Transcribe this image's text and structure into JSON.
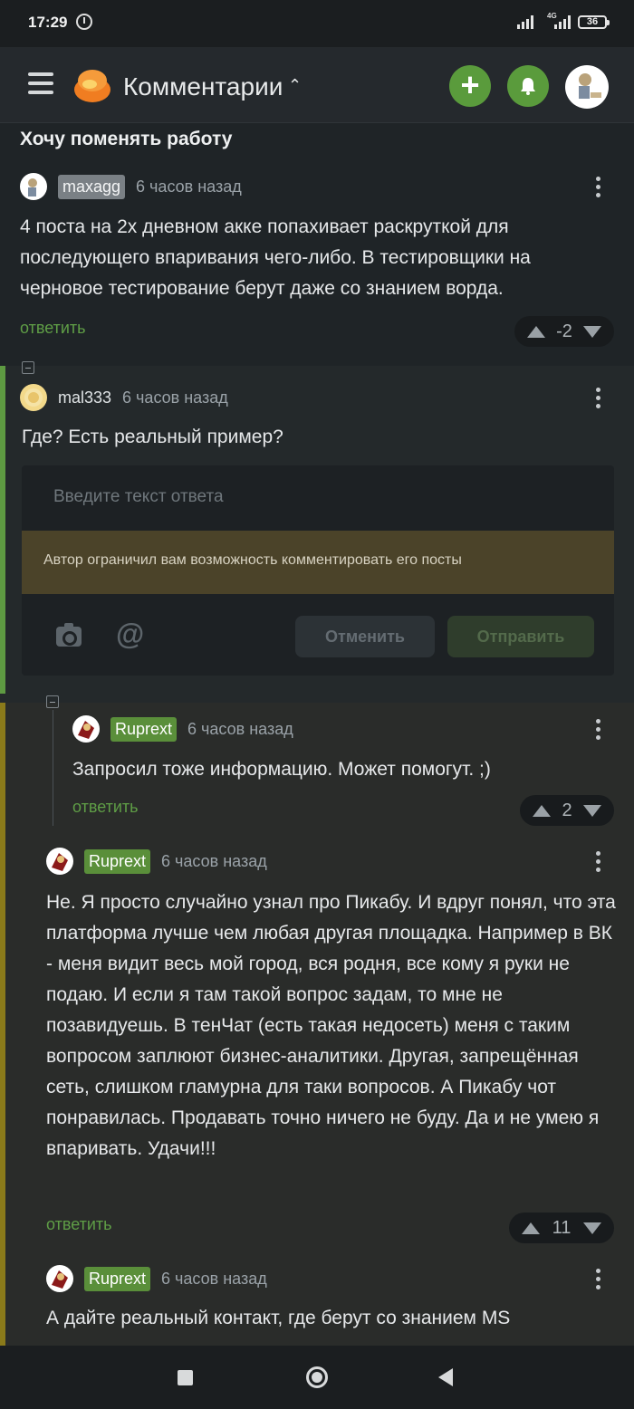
{
  "status_bar": {
    "time": "17:29",
    "network": "4G",
    "battery": "36"
  },
  "app_bar": {
    "title": "Комментарии",
    "chevron": "⌃"
  },
  "post": {
    "title": "Хочу поменять работу"
  },
  "comments": [
    {
      "user": "maxagg",
      "time": "6 часов назад",
      "text": "4 поста на 2х дневном акке попахивает раскруткой для последующего впаривания чего-либо. В тестировщики на черновое тестирование берут даже со знанием ворда.",
      "reply_label": "ответить",
      "rating": "-2"
    },
    {
      "user": "mal333",
      "time": "6 часов назад",
      "text": "Где? Есть реальный пример?"
    },
    {
      "user": "Ruprext",
      "time": "6 часов назад",
      "text": "Запросил тоже информацию. Может помогут. ;)",
      "reply_label": "ответить",
      "rating": "2"
    },
    {
      "user": "Ruprext",
      "time": "6 часов назад",
      "text": "Не. Я просто случайно узнал про Пикабу. И вдруг понял, что эта платформа лучше чем любая другая площадка. Например в ВК - меня видит весь мой город, вся родня, все кому я руки не подаю. И если я там такой вопрос задам, то мне не позавидуешь. В тенЧат (есть такая недосеть) меня с таким вопросом заплюют бизнес-аналитики. Другая, запрещённая сеть, слишком гламурна для таки вопросов. А Пикабу чот понравилась. Продавать точно ничего не буду. Да и не умею я впаривать. Удачи!!!",
      "reply_label": "ответить",
      "rating": "11"
    },
    {
      "user": "Ruprext",
      "time": "6 часов назад",
      "text": "А дайте реальный контакт, где берут со знанием MS"
    }
  ],
  "reply_form": {
    "placeholder": "Введите текст ответа",
    "notice": "Автор ограничил вам возможность комментировать его посты",
    "cancel_label": "Отменить",
    "send_label": "Отправить"
  },
  "colors": {
    "accent_green": "#5a9b3c",
    "background": "#1f2427"
  },
  "icons": [
    "menu-icon",
    "pikabu-logo",
    "plus-icon",
    "bell-icon",
    "more-vert-icon",
    "arrow-up-icon",
    "arrow-down-icon",
    "camera-icon",
    "at-icon"
  ]
}
